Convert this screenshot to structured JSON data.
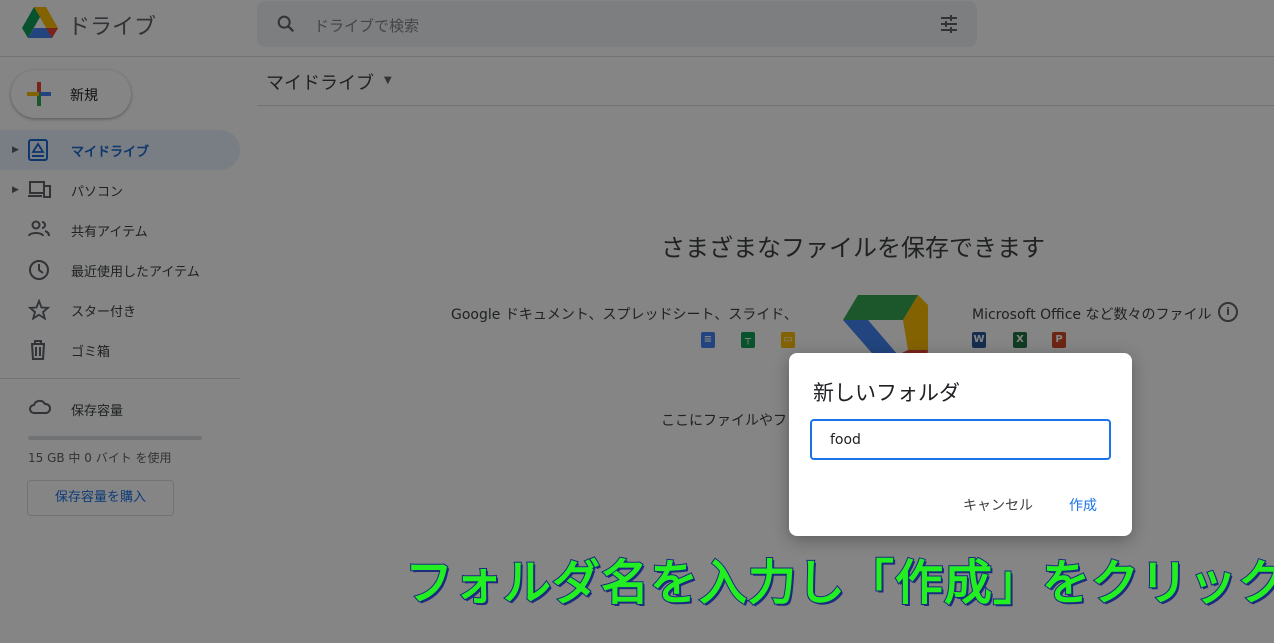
{
  "header": {
    "app_title": "ドライブ",
    "search_placeholder": "ドライブで検索"
  },
  "new_button": {
    "label": "新規"
  },
  "sidebar": {
    "items": [
      {
        "label": "マイドライブ",
        "icon": "my-drive-icon",
        "active": true,
        "expandable": true
      },
      {
        "label": "パソコン",
        "icon": "computers-icon",
        "expandable": true
      },
      {
        "label": "共有アイテム",
        "icon": "shared-icon"
      },
      {
        "label": "最近使用したアイテム",
        "icon": "clock-icon"
      },
      {
        "label": "スター付き",
        "icon": "star-icon"
      },
      {
        "label": "ゴミ箱",
        "icon": "trash-icon"
      }
    ],
    "storage": {
      "label": "保存容量",
      "usage": "15 GB 中 0 バイト を使用",
      "used_fraction": 0,
      "buy_label": "保存容量を購入"
    }
  },
  "breadcrumb": {
    "label": "マイドライブ"
  },
  "empty_state": {
    "title": "さまざまなファイルを保存できます",
    "google_text": "Google ドキュメント、スプレッドシート、スライド、",
    "ms_text": "Microsoft Office など数々のファイル",
    "drop_text": "ここにファイルやフ",
    "ms_icons": [
      "W",
      "X",
      "P"
    ]
  },
  "dialog": {
    "title": "新しいフォルダ",
    "input_value": "food",
    "cancel_label": "キャンセル",
    "create_label": "作成"
  },
  "caption": "フォルダ名を入力し「作成」をクリック",
  "colors": {
    "accent": "#1a73e8",
    "caption": "#22ee22",
    "caption_outline": "#1c2a80"
  }
}
